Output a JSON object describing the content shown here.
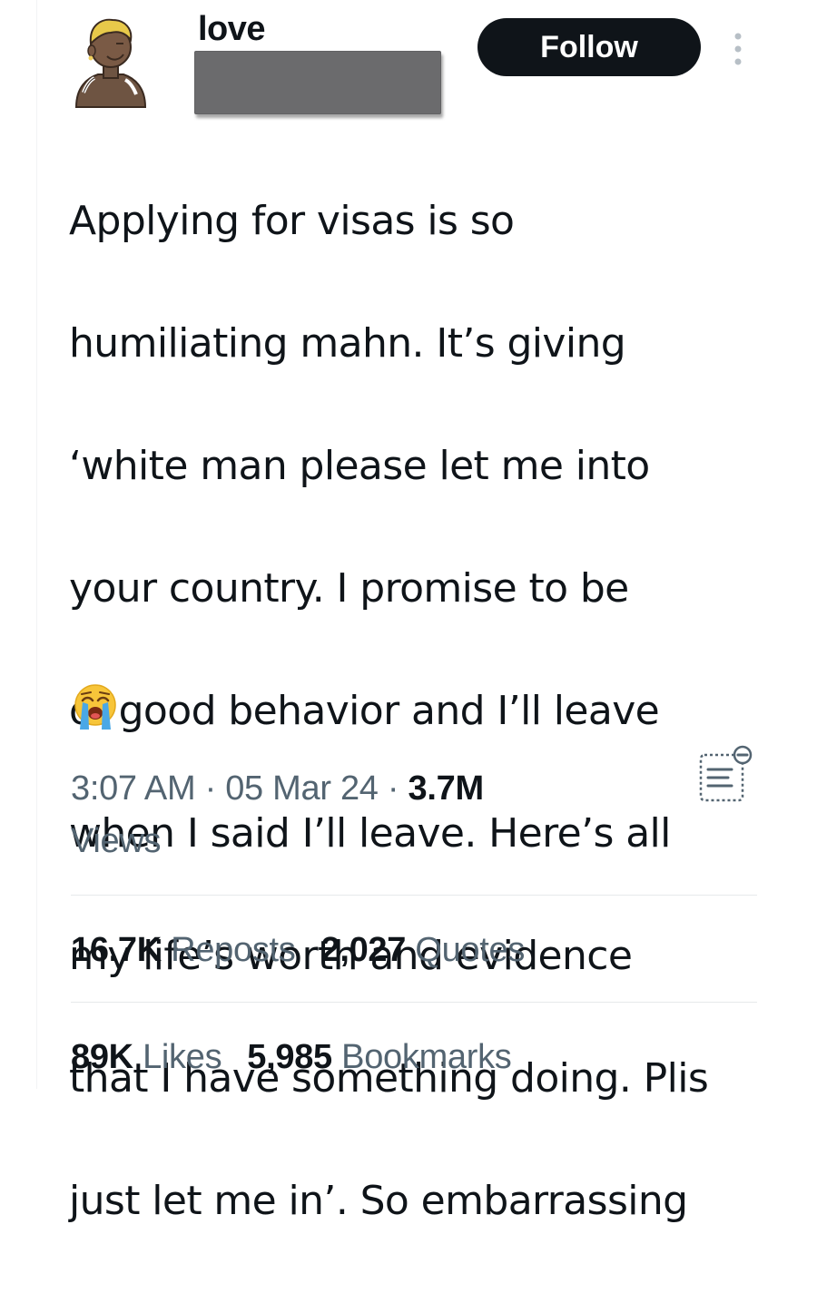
{
  "user": {
    "display_name": "love"
  },
  "actions": {
    "follow_label": "Follow"
  },
  "tweet": {
    "text_lines": [
      "Applying for visas is so",
      "humiliating mahn. It’s giving",
      "‘white man please let me into",
      "your country. I promise to be",
      "of good behavior and I’ll leave",
      "when I said I’ll leave. Here’s all",
      "my life’s worth and evidence",
      "that I have something doing. Plis",
      "just let me in’. So embarrassing"
    ],
    "emoji": "loudly-crying-face"
  },
  "meta": {
    "time": "3:07 AM",
    "separator": "·",
    "date": "05 Mar 24",
    "views_count": "3.7M",
    "views_label": "Views"
  },
  "stats": {
    "reposts_count": "16.7K",
    "reposts_label": "Reposts",
    "quotes_count": "2,027",
    "quotes_label": "Quotes",
    "likes_count": "89K",
    "likes_label": "Likes",
    "bookmarks_count": "5,985",
    "bookmarks_label": "Bookmarks"
  },
  "icons": {
    "more": "more-options-icon",
    "summary": "summary-icon"
  },
  "colors": {
    "text_primary": "#0f1419",
    "text_secondary": "#536471",
    "button_bg": "#0f1419",
    "redaction": "#6b6b6d"
  }
}
